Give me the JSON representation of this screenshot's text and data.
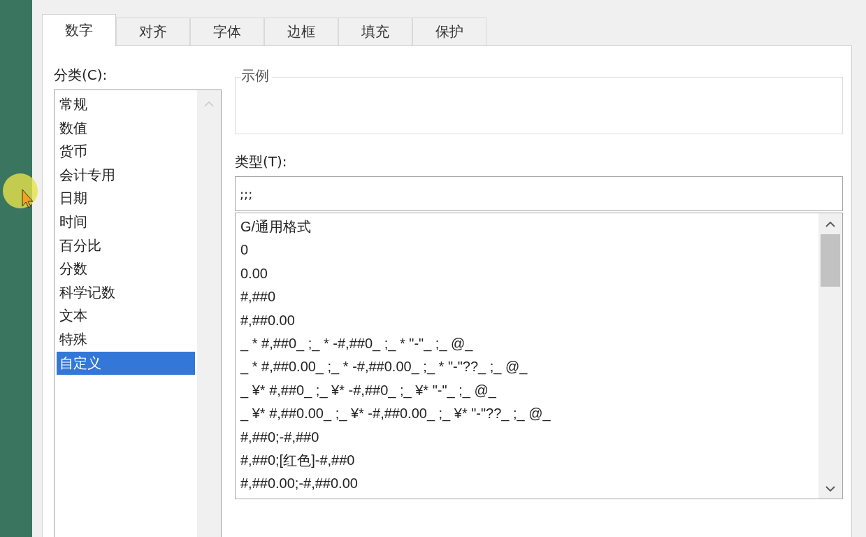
{
  "tabs": [
    {
      "label": "数字",
      "selected": true
    },
    {
      "label": "对齐",
      "selected": false
    },
    {
      "label": "字体",
      "selected": false
    },
    {
      "label": "边框",
      "selected": false
    },
    {
      "label": "填充",
      "selected": false
    },
    {
      "label": "保护",
      "selected": false
    }
  ],
  "category": {
    "label": "分类(C):",
    "items": [
      {
        "label": "常规",
        "selected": false
      },
      {
        "label": "数值",
        "selected": false
      },
      {
        "label": "货币",
        "selected": false
      },
      {
        "label": "会计专用",
        "selected": false
      },
      {
        "label": "日期",
        "selected": false
      },
      {
        "label": "时间",
        "selected": false
      },
      {
        "label": "百分比",
        "selected": false
      },
      {
        "label": "分数",
        "selected": false
      },
      {
        "label": "科学记数",
        "selected": false
      },
      {
        "label": "文本",
        "selected": false
      },
      {
        "label": "特殊",
        "selected": false
      },
      {
        "label": "自定义",
        "selected": true
      }
    ]
  },
  "sample": {
    "title": "示例"
  },
  "type": {
    "label": "类型(T):",
    "value": ";;;"
  },
  "formats": [
    {
      "label": "G/通用格式"
    },
    {
      "label": "0"
    },
    {
      "label": "0.00"
    },
    {
      "label": "#,##0"
    },
    {
      "label": "#,##0.00"
    },
    {
      "label": "_ * #,##0_ ;_ * -#,##0_ ;_ * \"-\"_ ;_ @_"
    },
    {
      "label": "_ * #,##0.00_ ;_ * -#,##0.00_ ;_ * \"-\"??_ ;_ @_"
    },
    {
      "label": "_ ¥* #,##0_ ;_ ¥* -#,##0_ ;_ ¥* \"-\"_ ;_ @_"
    },
    {
      "label": "_ ¥* #,##0.00_ ;_ ¥* -#,##0.00_ ;_ ¥* \"-\"??_ ;_ @_"
    },
    {
      "label": "#,##0;-#,##0"
    },
    {
      "label": "#,##0;[红色]-#,##0"
    },
    {
      "label": "#,##0.00;-#,##0.00"
    }
  ]
}
